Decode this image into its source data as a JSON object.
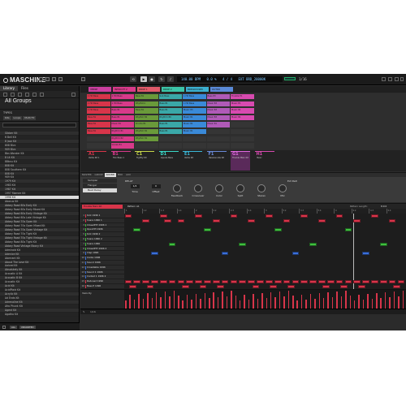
{
  "app": {
    "name": "MASCHINE"
  },
  "transport": {
    "tempo": "140.00 BPM",
    "swing": "0.0 %",
    "sig": "4 / 4",
    "extra": "EXT  BRD_20000K",
    "position": "1/16"
  },
  "library": {
    "tabs": [
      "Library",
      "Files"
    ],
    "heading": "All Groups",
    "types_label": "TYPES",
    "type_chips": [
      "Kits",
      "Loops",
      "Multi FX"
    ],
    "groups": [
      "Gibber Kit",
      "6 Bell Kit",
      "8 Jazz Kit",
      "808 Blvc",
      "909 Blvc",
      "Bbs Wonder Kit",
      "8 Lit Kit",
      "88bnu Kit",
      "808 Kit",
      "808 Southern Kit",
      "808 Kit",
      "909 Kit",
      "1979 Kit",
      "1983 Kit",
      "1987 Kit",
      "1997 Mamee Kit",
      "1996 Kit",
      "Abacus Kit",
      "Abbey Road 60s Early Kit",
      "Abbey Road 60s Early Mixed Kit",
      "Abbey Road 60s Early Vintage Kit",
      "Abbey Road 60s Late Vintage Kit",
      "Abbey Road 70s Open Kit",
      "Abbey Road 70s Open Mixed Kit",
      "Abbey Road 70s Open Vintage Kit",
      "Abbey Road 70s Tight Kit",
      "Abbey Road 70s Tight Vintage Kit",
      "Abbey Road 80s Tight Kit",
      "Abbey Road Vintage Ebony Kit",
      "Admirald Kit",
      "Adenice Kit",
      "Aberrant Kit",
      "About The Love Kit",
      "Aalced Kit",
      "Absolutely Kit",
      "Acoustic A Kit",
      "Acoustic B Kit",
      "Acoustic Kit",
      "Acid Kit",
      "AcidPlaid Kit",
      "Acrylic Kit",
      "Ad Ends Kit",
      "Adrenaline Kit",
      "Afro Phunk Kit",
      "Agent Kit",
      "Agatho Kit"
    ],
    "selected_index": 16,
    "bottom_buttons": [
      "ALL",
      "UNSORTED"
    ]
  },
  "scenes": [
    "VERSE",
    "INTRO PT 2",
    "DROP 1",
    "DROP 2",
    "BREAKDOWN",
    "OUTRO"
  ],
  "clips": [
    [
      {
        "t": "1 Hit Bass"
      },
      {
        "t": "1 Hit Bass"
      },
      {
        "t": "Bass 81"
      },
      {
        "t": "Sub Bass"
      },
      {
        "t": "1 Hit Bass"
      },
      {
        "t": "Bass 83"
      },
      {
        "t": "Trouble E1"
      }
    ],
    [
      {
        "t": "1 Hit Bass"
      },
      {
        "t": "1 Hit Bass"
      },
      {
        "t": "Rhythmic"
      },
      {
        "t": "Bass 81"
      },
      {
        "t": "1 Hit Bass"
      },
      {
        "t": "Music 83"
      },
      {
        "t": "Music E1"
      }
    ],
    [
      {
        "t": "1 Hit Bass"
      },
      {
        "t": "Bass 81"
      },
      {
        "t": "Bass 81"
      },
      {
        "t": "Bass 81"
      },
      {
        "t": "Music 83"
      },
      {
        "t": "Music 83"
      },
      {
        "t": "Music 81"
      }
    ],
    [
      {
        "t": "Bass 81"
      },
      {
        "t": "Bass 81"
      },
      {
        "t": "Rhythm 82"
      },
      {
        "t": "Rhythm 80"
      },
      {
        "t": "Music 81"
      },
      {
        "t": "Music 83"
      },
      {
        "t": "Music 81"
      }
    ],
    [
      {
        "t": "Bass 81"
      },
      {
        "t": "Music 81"
      },
      {
        "t": "Drums 81"
      },
      {
        "t": "Bass 81"
      },
      {
        "t": "Music 81"
      },
      {
        "t": "Music 81"
      },
      {
        "t": ""
      }
    ],
    [
      {
        "t": "Bass 81"
      },
      {
        "t": "Rhythm 81"
      },
      {
        "t": "Rhythm 81"
      },
      {
        "t": "Bass 81"
      },
      {
        "t": "Music 81"
      },
      {
        "t": ""
      },
      {
        "t": ""
      }
    ],
    [
      {
        "t": ""
      },
      {
        "t": "Rhythm 82"
      },
      {
        "t": "Rhythm 81"
      },
      {
        "t": ""
      },
      {
        "t": ""
      },
      {
        "t": ""
      },
      {
        "t": ""
      }
    ],
    [
      {
        "t": ""
      },
      {
        "t": "Vocals 81"
      },
      {
        "t": ""
      },
      {
        "t": ""
      },
      {
        "t": ""
      },
      {
        "t": ""
      },
      {
        "t": ""
      }
    ]
  ],
  "groups_strip": [
    {
      "id": "A1",
      "name": "Verbs Kit 1"
    },
    {
      "id": "B1",
      "name": "Thin Bass 1"
    },
    {
      "id": "C1",
      "name": "Tightly Kit"
    },
    {
      "id": "D1",
      "name": "Square Bass"
    },
    {
      "id": "E1",
      "name": "Verbs Kit"
    },
    {
      "id": "F1",
      "name": "Massive Lite Kit"
    },
    {
      "id": "G1",
      "name": "Trouble Main Kit"
    },
    {
      "id": "H1",
      "name": "Music"
    }
  ],
  "control": {
    "tabs": [
      "MASTER",
      "GROUP",
      "SOUND",
      "MIDI",
      "AUX"
    ],
    "active_tab": "SOUND",
    "plugins": [
      "Sampler",
      "Flanger",
      "Beat Delay"
    ],
    "active_plugin": "Beat Delay",
    "section": "DELAY",
    "section2": "Ext Pedl",
    "params": [
      {
        "label": "Time",
        "value": "1/4"
      },
      {
        "label": "Offset",
        "value": "0"
      },
      {
        "label": "Feedback"
      },
      {
        "label": "Crossover"
      },
      {
        "label": "Color"
      },
      {
        "label": "Spilt"
      },
      {
        "label": "Stereo"
      },
      {
        "label": "Mix"
      }
    ]
  },
  "pattern": {
    "group": "Trouble Main Kit",
    "pattern": "Pattern A1",
    "length_label": "Pattern Length:",
    "length": "8:0:0"
  },
  "ruler": [
    "1",
    "1.2",
    "1.3",
    "1.4",
    "2",
    "2.2",
    "2.3",
    "2.4",
    "3",
    "3.2",
    "3.3",
    "3.4",
    "4",
    "4.2",
    "4.3",
    "4.4"
  ],
  "sounds": [
    {
      "n": "1",
      "name": "Kick 1996 1",
      "c": "#d8354a"
    },
    {
      "n": "2",
      "name": "Snare 1996 1",
      "c": "#d8354a"
    },
    {
      "n": "3",
      "name": "ClosedHH 1996 1",
      "c": "#3fbf3f"
    },
    {
      "n": "4",
      "name": "OpenHH 1996",
      "c": "#3fbf3f"
    },
    {
      "n": "5",
      "name": "Kick 1996 2",
      "c": "#3fbf3f"
    },
    {
      "n": "6",
      "name": "Snare 1996 2",
      "c": "#3fbf3f"
    },
    {
      "n": "7",
      "name": "Snare 1996",
      "c": "#3fbf3f"
    },
    {
      "n": "8",
      "name": "ClosedHH 1996 2",
      "c": "#3fbf3f"
    },
    {
      "n": "9",
      "name": "Clap 1996",
      "c": "#3b6fd8"
    },
    {
      "n": "10",
      "name": "Conta 1996",
      "c": "#3b6fd8"
    },
    {
      "n": "11",
      "name": "Sound 1996",
      "c": "#3b6fd8"
    },
    {
      "n": "12",
      "name": "Crosstable 1996",
      "c": "#3b6fd8"
    },
    {
      "n": "13",
      "name": "Sound 1 1996",
      "c": "#3b6fd8"
    },
    {
      "n": "14",
      "name": "Conted 1 1996 2",
      "c": "#3b6fd8"
    },
    {
      "n": "15",
      "name": "Detuned 1996",
      "c": "#d8354a"
    },
    {
      "n": "16",
      "name": "Bass P 1996",
      "c": "#d8354a"
    }
  ],
  "velocity_label": "Velocity",
  "footer": {
    "zoom": "1/16"
  },
  "colors": {
    "red": "#d8354a",
    "green": "#3fbf3f",
    "blue": "#3b6fd8"
  },
  "icons": [
    "browser-icon",
    "mixer-icon",
    "record-icon",
    "restart-icon",
    "play-icon",
    "stop-icon",
    "metronome-icon",
    "save-icon",
    "search-icon",
    "settings-icon"
  ]
}
